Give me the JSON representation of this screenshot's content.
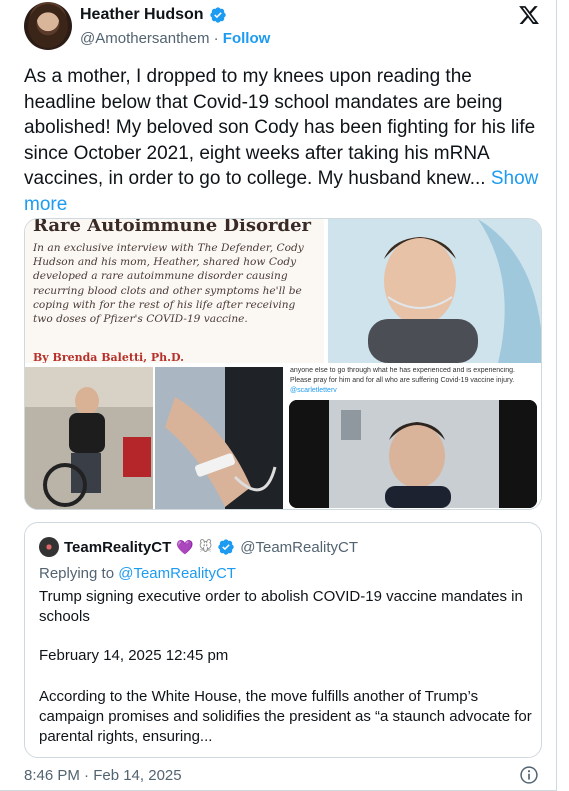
{
  "author": {
    "name": "Heather Hudson",
    "handle": "@Amothersanthem",
    "separator": " · ",
    "follow_label": "Follow"
  },
  "tweet": {
    "text": "As a mother, I dropped to my knees upon reading the headline below that Covid-19 school mandates are being abolished! My beloved son Cody has been fighting for his life since October 2021, eight weeks after taking his mRNA vaccines, in order to go to college. My husband knew... ",
    "show_more_label": "Show more"
  },
  "media": {
    "article_heading": "Rare Autoimmune Disorder",
    "article_body": "In an exclusive interview with The Defender, Cody Hudson and his mom, Heather, shared how Cody developed a rare autoimmune disorder causing recurring blood clots and other symptoms he'll be coping with for the rest of his life after receiving two doses of Pfizer's COVID-19 vaccine.",
    "article_byline": "By Brenda Baletti, Ph.D.",
    "caption_text": "anyone else to go through what he has experienced and is experiencing. Please pray for him and for all who are suffering Covid-19 vaccine injury.",
    "caption_tag": "@scarletletterv"
  },
  "quote": {
    "name": "TeamRealityCT",
    "emojis": "💜",
    "emoji2": "🐭",
    "handle": "@TeamRealityCT",
    "replying_prefix": "Replying to ",
    "replying_handle": "@TeamRealityCT",
    "text": "Trump signing executive order to abolish COVID-19 vaccine mandates in schools",
    "date": "February 14, 2025 12:45 pm",
    "paragraph": "According to the White House, the move fulfills another of Trump’s campaign promises and solidifies the president as “a staunch advocate for parental rights, ensuring..."
  },
  "footer": {
    "timestamp": "8:46 PM · Feb 14, 2025"
  },
  "colors": {
    "accent": "#1d9bf0",
    "text": "#0f1419",
    "muted": "#536471",
    "border": "#cfd9de"
  },
  "icons": [
    "verified-badge-icon",
    "x-logo-icon",
    "info-icon"
  ]
}
